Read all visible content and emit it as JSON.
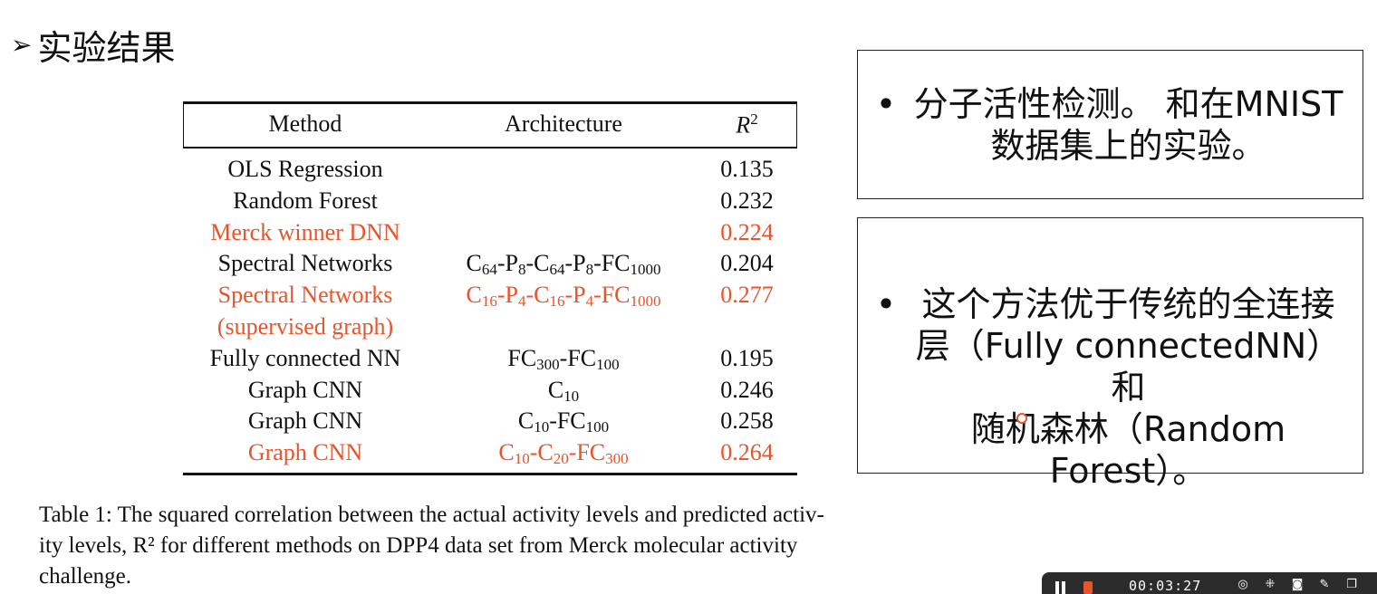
{
  "slide": {
    "heading": "实验结果",
    "arrow_icon": "➢"
  },
  "table": {
    "headers": {
      "method": "Method",
      "architecture": "Architecture",
      "r2": "R",
      "r2_sup": "2"
    },
    "rows": [
      {
        "method": "OLS Regression",
        "arch": [],
        "r2": "0.135",
        "highlight": false
      },
      {
        "method": "Random Forest",
        "arch": [],
        "r2": "0.232",
        "highlight": false
      },
      {
        "method": "Merck winner DNN",
        "arch": [],
        "r2": "0.224",
        "highlight": true
      },
      {
        "method": "Spectral Networks",
        "arch": [
          [
            "C",
            "64"
          ],
          [
            "-P",
            "8"
          ],
          [
            "-C",
            "64"
          ],
          [
            "-P",
            "8"
          ],
          [
            "-FC",
            "1000"
          ]
        ],
        "r2": "0.204",
        "highlight": false
      },
      {
        "method": "Spectral Networks",
        "arch": [
          [
            "C",
            "16"
          ],
          [
            "-P",
            "4"
          ],
          [
            "-C",
            "16"
          ],
          [
            "-P",
            "4"
          ],
          [
            "-FC",
            "1000"
          ]
        ],
        "r2": "0.277",
        "highlight": true
      },
      {
        "method": "(supervised graph)",
        "arch": [],
        "r2": "",
        "highlight": true
      },
      {
        "method": "Fully connected NN",
        "arch": [
          [
            "FC",
            "300"
          ],
          [
            "-FC",
            "100"
          ]
        ],
        "r2": "0.195",
        "highlight": false
      },
      {
        "method": "Graph CNN",
        "arch": [
          [
            "C",
            "10"
          ]
        ],
        "r2": "0.246",
        "highlight": false
      },
      {
        "method": "Graph CNN",
        "arch": [
          [
            "C",
            "10"
          ],
          [
            "-FC",
            "100"
          ]
        ],
        "r2": "0.258",
        "highlight": false
      },
      {
        "method": "Graph CNN",
        "arch": [
          [
            "C",
            "10"
          ],
          [
            "-C",
            "20"
          ],
          [
            "-FC",
            "300"
          ]
        ],
        "r2": "0.264",
        "highlight": true
      }
    ],
    "caption_lines": [
      "Table 1: The squared correlation between the actual activity levels and predicted activ-",
      "ity levels, R² for different methods on DPP4 data set from Merck molecular activity",
      "challenge."
    ]
  },
  "notes": [
    {
      "bullet": "•",
      "lines": [
        "分子活性检测。 和在MNIST",
        "数据集上的实验。"
      ]
    },
    {
      "bullet": "•",
      "lines": [
        "这个方法优于传统的全连接",
        "层（Fully connectedNN） 和",
        "随机森林（Random Forest）。"
      ]
    }
  ],
  "player": {
    "time": "00:03:27",
    "icons": [
      "pause-icon",
      "record-indicator",
      "target-icon",
      "collapse-icon",
      "camera-icon",
      "pen-icon",
      "window-icon"
    ]
  },
  "colors": {
    "highlight": "#e8542b",
    "text": "#111111"
  }
}
